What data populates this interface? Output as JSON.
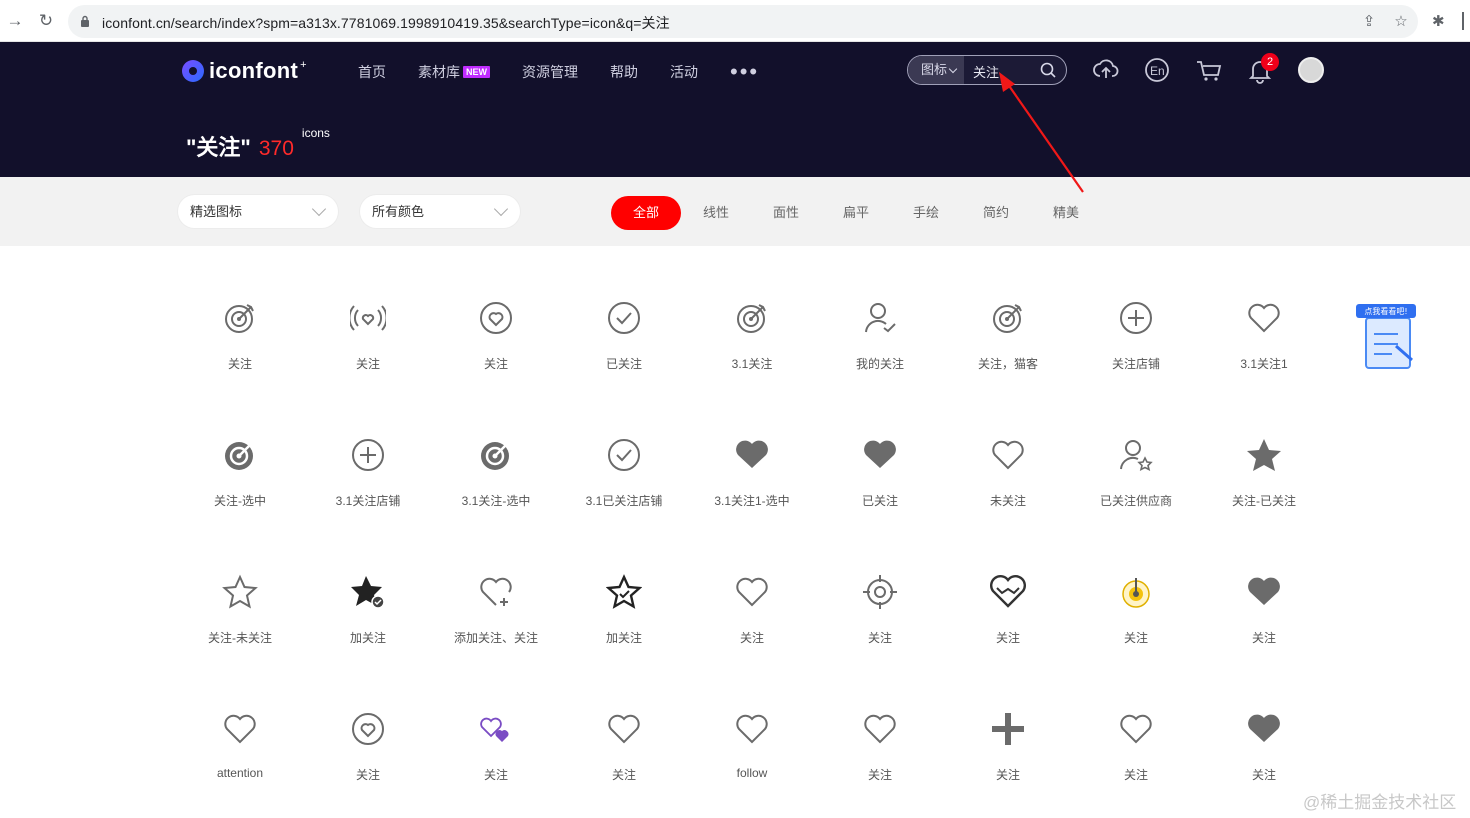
{
  "browser": {
    "url": "iconfont.cn/search/index?spm=a313x.7781069.1998910419.35&searchType=icon&q=关注"
  },
  "header": {
    "logo": "iconfont",
    "nav": [
      {
        "label": "首页"
      },
      {
        "label": "素材库",
        "badge": "NEW"
      },
      {
        "label": "资源管理"
      },
      {
        "label": "帮助"
      },
      {
        "label": "活动"
      }
    ],
    "more": "•••",
    "search": {
      "type": "图标",
      "query": "关注"
    },
    "notifications": "2",
    "accent": "#ff2a2a",
    "bg": "#12102b"
  },
  "results": {
    "query": "\"关注\"",
    "count": "370",
    "unit": "icons"
  },
  "filters": {
    "select1": "精选图标",
    "select2": "所有颜色",
    "tabs": [
      "全部",
      "线性",
      "面性",
      "扁平",
      "手绘",
      "简约",
      "精美"
    ],
    "active_tab": "全部"
  },
  "icons": [
    {
      "label": "关注",
      "icon": "target-outline-icon"
    },
    {
      "label": "关注",
      "icon": "broadcast-heart-icon"
    },
    {
      "label": "关注",
      "icon": "circle-heart-icon"
    },
    {
      "label": "已关注",
      "icon": "circle-check-icon"
    },
    {
      "label": "3.1关注",
      "icon": "target-outline-icon"
    },
    {
      "label": "我的关注",
      "icon": "user-check-icon"
    },
    {
      "label": "关注，猫客",
      "icon": "target-outline-icon"
    },
    {
      "label": "关注店铺",
      "icon": "circle-plus-icon"
    },
    {
      "label": "3.1关注1",
      "icon": "heart-outline-icon"
    },
    {
      "label": "关注-选中",
      "icon": "target-filled-icon"
    },
    {
      "label": "3.1关注店铺",
      "icon": "circle-plus-icon"
    },
    {
      "label": "3.1关注-选中",
      "icon": "target-filled-icon"
    },
    {
      "label": "3.1已关注店铺",
      "icon": "circle-check-icon"
    },
    {
      "label": "3.1关注1-选中",
      "icon": "heart-filled-icon"
    },
    {
      "label": "已关注",
      "icon": "heart-filled-icon"
    },
    {
      "label": "未关注",
      "icon": "heart-outline-icon"
    },
    {
      "label": "已关注供应商",
      "icon": "user-star-icon"
    },
    {
      "label": "关注-已关注",
      "icon": "star-filled-icon"
    },
    {
      "label": "关注-未关注",
      "icon": "star-outline-icon"
    },
    {
      "label": "加关注",
      "icon": "star-check-icon"
    },
    {
      "label": "添加关注、关注",
      "icon": "heart-plus-icon"
    },
    {
      "label": "加关注",
      "icon": "star-double-icon"
    },
    {
      "label": "关注",
      "icon": "heart-outline-icon"
    },
    {
      "label": "关注",
      "icon": "crosshair-icon"
    },
    {
      "label": "关注",
      "icon": "heart-double-icon"
    },
    {
      "label": "关注",
      "icon": "gold-target-icon"
    },
    {
      "label": "关注",
      "icon": "heart-filled-icon"
    },
    {
      "label": "attention",
      "icon": "heart-outline-icon"
    },
    {
      "label": "关注",
      "icon": "circle-heart-icon"
    },
    {
      "label": "关注",
      "icon": "purple-hearts-icon"
    },
    {
      "label": "关注",
      "icon": "heart-outline-icon"
    },
    {
      "label": "follow",
      "icon": "heart-outline-icon"
    },
    {
      "label": "关注",
      "icon": "heart-outline-icon"
    },
    {
      "label": "关注",
      "icon": "plus-icon"
    },
    {
      "label": "关注",
      "icon": "heart-outline-icon"
    },
    {
      "label": "关注",
      "icon": "heart-filled-icon"
    }
  ],
  "promo": {
    "label": "点我看看吧!"
  },
  "watermark": "@稀土掘金技术社区"
}
